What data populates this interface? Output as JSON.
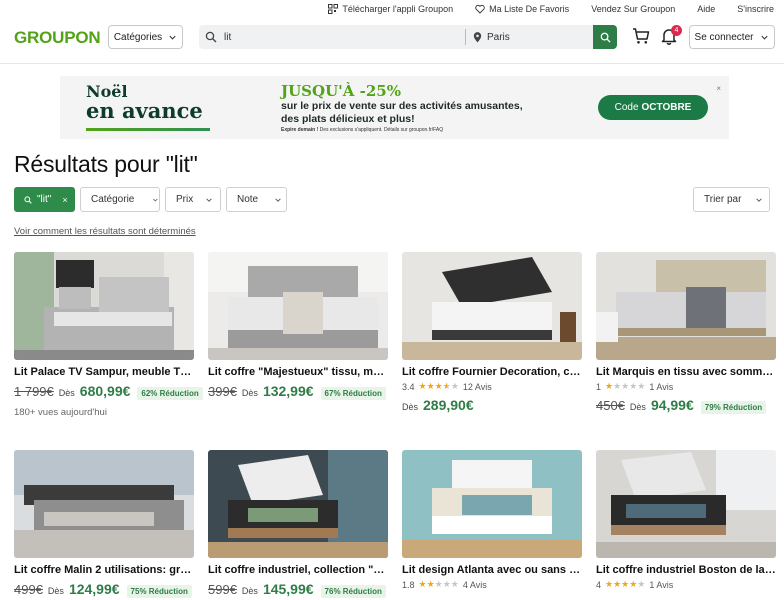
{
  "top_links": [
    {
      "label": "Télécharger l'appli Groupon",
      "icon": "qr-code-icon"
    },
    {
      "label": "Ma Liste De Favoris",
      "icon": "heart-icon"
    },
    {
      "label": "Vendez Sur Groupon",
      "icon": ""
    },
    {
      "label": "Aide",
      "icon": ""
    },
    {
      "label": "S'inscrire",
      "icon": ""
    }
  ],
  "header": {
    "logo": "GROUPON",
    "categories_label": "Catégories",
    "search_value": "lit",
    "location_value": "Paris",
    "notification_count": "4",
    "login_label": "Se connecter"
  },
  "banner": {
    "title_line1": "Noël",
    "title_line2": "en avance",
    "promo": "JUSQU'À -25%",
    "line2": "sur le prix de vente sur des activités amusantes,",
    "line3": "des plats délicieux et plus!",
    "fine_bold": "Expire demain !",
    "fine_rest": "Des exclusions s'appliquent. Détails sur groupon.fr/FAQ",
    "code_prefix": "Code",
    "code_value": "OCTOBRE",
    "close": "×"
  },
  "results_heading": "Résultats pour \"lit\"",
  "filters": {
    "active_chip": "\"lit\"",
    "active_close": "×",
    "categorie": "Catégorie",
    "prix": "Prix",
    "note": "Note",
    "sort": "Trier par"
  },
  "explain_link": "Voir comment les résultats sont déterminés",
  "products": [
    {
      "title": "Lit Palace TV Sampur, meuble TV ...",
      "old": "1 799€",
      "des": "Dès",
      "new": "680,99€",
      "disc": "62% Réduction",
      "views": "180+ vues aujourd'hui"
    },
    {
      "title": "Lit coffre \"Majestueux\" tissu, ma...",
      "old": "399€",
      "des": "Dès",
      "new": "132,99€",
      "disc": "67% Réduction"
    },
    {
      "title": "Lit coffre Fournier Decoration, co...",
      "rating_value": "3.4",
      "rating_stars": 3.5,
      "reviews": "12 Avis",
      "des": "Dès",
      "new": "289,90€"
    },
    {
      "title": "Lit Marquis en tissu avec sommie...",
      "rating_value": "1",
      "rating_stars": 1,
      "reviews": "1 Avis",
      "old": "450€",
      "des": "Dès",
      "new": "94,99€",
      "disc": "79% Réduction"
    },
    {
      "title": "Lit coffre Malin 2 utilisations: gra...",
      "old": "499€",
      "des": "Dès",
      "new": "124,99€",
      "disc": "75% Réduction"
    },
    {
      "title": "Lit coffre industriel, collection \"C...",
      "old": "599€",
      "des": "Dès",
      "new": "145,99€",
      "disc": "76% Réduction"
    },
    {
      "title": "Lit design Atlanta avec ou sans m...",
      "rating_value": "1.8",
      "rating_stars": 2,
      "reviews": "4 Avis"
    },
    {
      "title": "Lit coffre industriel Boston de la ...",
      "rating_value": "4",
      "rating_stars": 4,
      "reviews": "1 Avis"
    }
  ],
  "colors": {
    "brand_green": "#53a318",
    "price_green": "#2e7d46",
    "badge_red": "#e0284f"
  }
}
